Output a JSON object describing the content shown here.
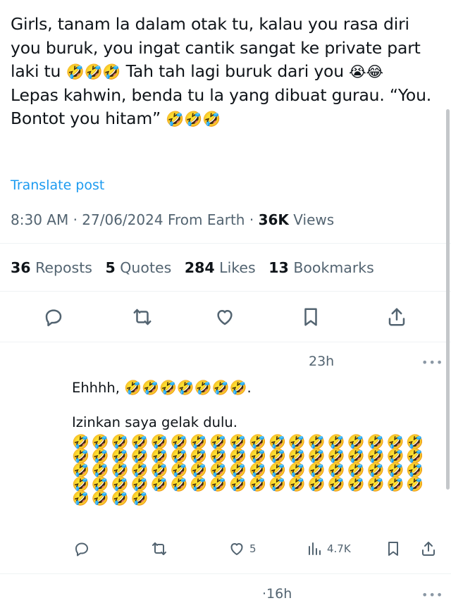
{
  "post": {
    "segments": [
      {
        "type": "text",
        "value": "Girls, tanam la dalam otak tu, kalau you rasa diri you buruk, you ingat cantik sangat ke private part laki tu "
      },
      {
        "type": "emoji",
        "value": "🤣🤣🤣"
      },
      {
        "type": "text",
        "value": " Tah tah lagi buruk dari you "
      },
      {
        "type": "emoji",
        "value": "😭😂"
      },
      {
        "type": "text",
        "value": " Lepas kahwin, benda tu la yang dibuat gurau. “You. Bontot you hitam” "
      },
      {
        "type": "emoji",
        "value": "🤣🤣🤣"
      }
    ],
    "translate_label": "Translate post",
    "meta": {
      "time": "8:30 AM",
      "date": "27/06/2024",
      "source": "From Earth",
      "views_count": "36K",
      "views_label": "Views"
    },
    "stats": {
      "reposts_count": "36",
      "reposts_label": "Reposts",
      "quotes_count": "5",
      "quotes_label": "Quotes",
      "likes_count": "284",
      "likes_label": "Likes",
      "bookmarks_count": "13",
      "bookmarks_label": "Bookmarks"
    },
    "actions": [
      "reply-icon",
      "repost-icon",
      "like-icon",
      "bookmark-icon",
      "share-icon"
    ]
  },
  "reply": {
    "time": "23h",
    "more": "•••",
    "line1_text": "Ehhhh, ",
    "line1_emoji": "🤣🤣🤣🤣🤣🤣🤣",
    "line1_end": ".",
    "line2_text": "Izinkan saya gelak dulu. ",
    "line2_emoji": "🤣🤣🤣🤣🤣🤣🤣🤣🤣🤣🤣🤣🤣🤣🤣🤣🤣🤣🤣🤣🤣🤣🤣🤣🤣🤣🤣🤣🤣🤣🤣🤣🤣🤣🤣🤣🤣🤣🤣🤣🤣🤣🤣🤣🤣🤣🤣🤣🤣🤣🤣🤣🤣🤣🤣🤣🤣🤣🤣🤣🤣🤣🤣🤣🤣🤣🤣🤣🤣🤣🤣🤣🤣🤣🤣🤣",
    "likes": "5",
    "views": "4.7K"
  },
  "next_reply": {
    "time": "·16h",
    "more": "•••"
  },
  "colors": {
    "text": "#0f1419",
    "secondary": "#536471",
    "link": "#1d9bf0"
  }
}
